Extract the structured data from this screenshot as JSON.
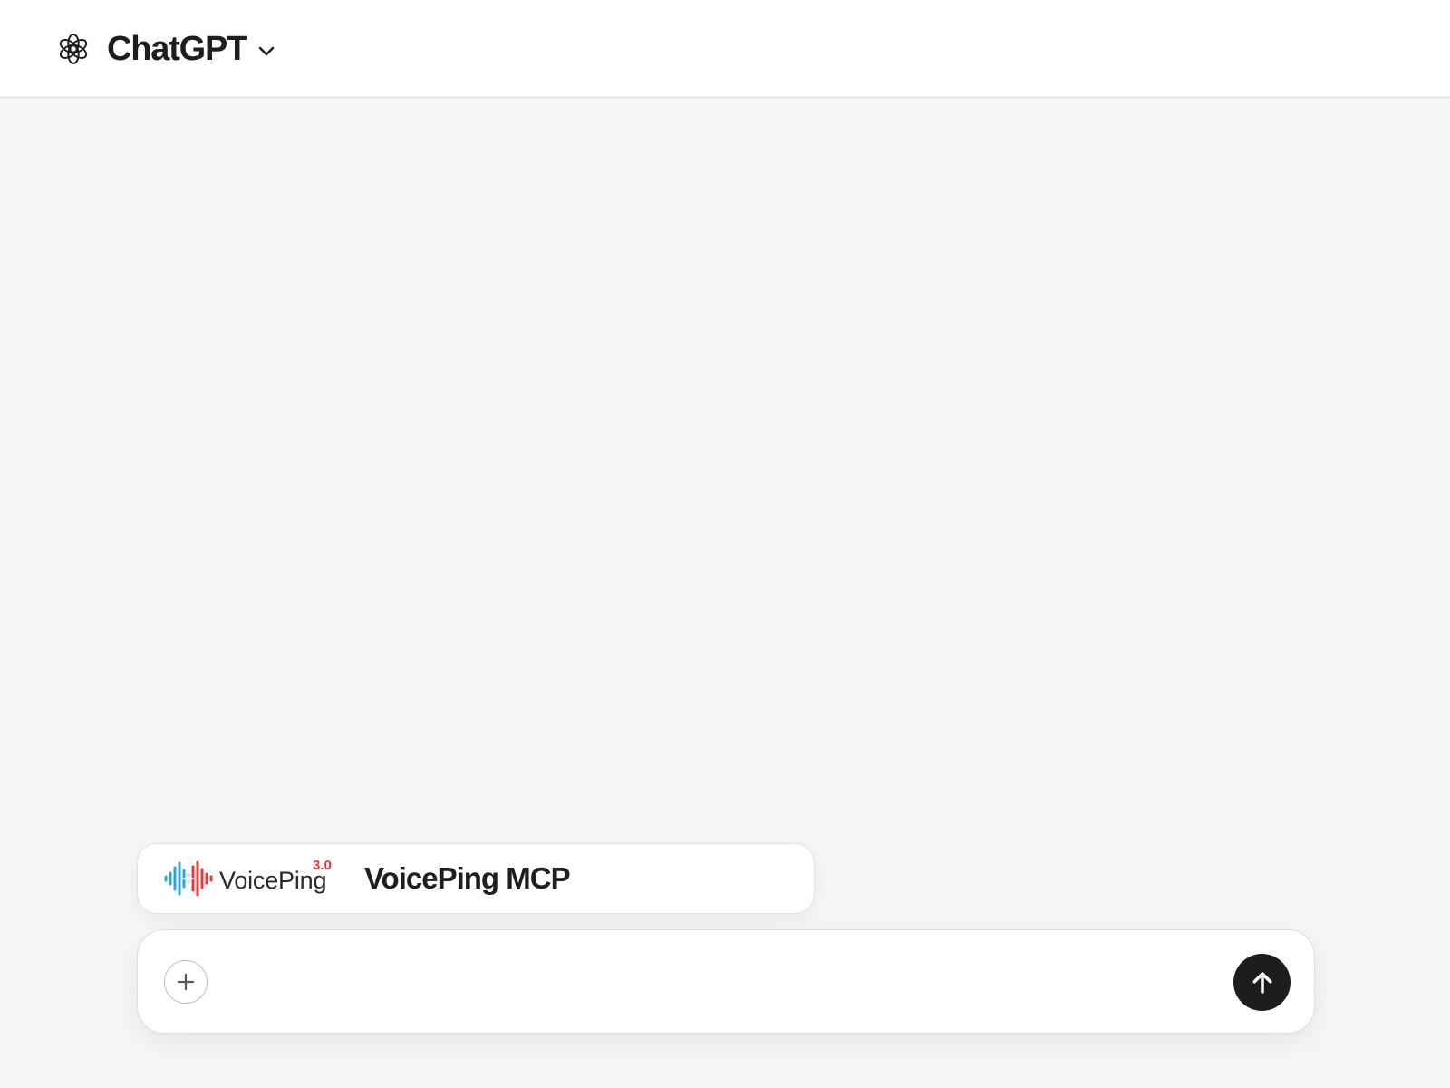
{
  "header": {
    "title": "ChatGPT",
    "logo_icon": "openai-logo-icon",
    "dropdown_icon": "chevron-down-icon"
  },
  "app_card": {
    "logo_wordmark": "VoicePing",
    "logo_version": "3.0",
    "name": "VoicePing MCP",
    "logo_colors": {
      "left": "#2aa6d6",
      "right": "#e53b3b"
    }
  },
  "composer": {
    "placeholder": "",
    "value": "",
    "attach_icon": "plus-icon",
    "send_icon": "arrow-up-icon"
  },
  "colors": {
    "page_background": "#f6f6f6",
    "header_background": "#ffffff",
    "send_button": "#1d1d1f"
  }
}
